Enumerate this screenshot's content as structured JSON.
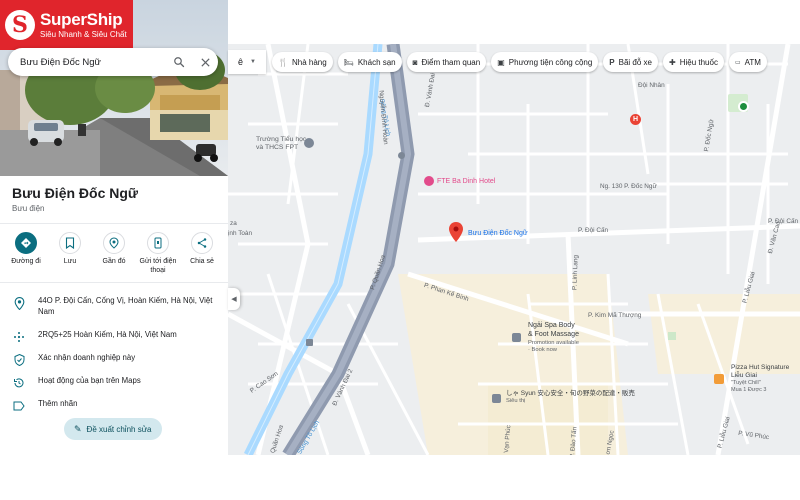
{
  "brand": {
    "logo_letter": "S",
    "name": "SuperShip",
    "slogan": "Siêu Nhanh & Siêu Chất"
  },
  "search": {
    "value": "Bưu Điện Đốc Ngữ",
    "placeholder": ""
  },
  "place": {
    "title": "Bưu Điện Đốc Ngữ",
    "category": "Bưu điện"
  },
  "actions": [
    {
      "label": "Đường đi",
      "icon": "directions-icon"
    },
    {
      "label": "Lưu",
      "icon": "bookmark-icon"
    },
    {
      "label": "Gần đó",
      "icon": "nearby-icon"
    },
    {
      "label": "Gửi tới điện thoại",
      "icon": "send-to-phone-icon"
    },
    {
      "label": "Chia sẻ",
      "icon": "share-icon"
    }
  ],
  "info": {
    "address": "44O P. Đội Cấn, Cống Vị, Hoàn Kiếm, Hà Nội, Việt Nam",
    "plus_code": "2RQ5+25 Hoàn Kiếm, Hà Nội, Việt Nam",
    "claim": "Xác nhận doanh nghiệp này",
    "activity": "Hoạt động của bạn trên Maps",
    "label": "Thêm nhãn"
  },
  "suggest_edit": "Đề xuất chỉnh sửa",
  "language_chip": "ê",
  "chips": [
    {
      "label": "Nhà hàng",
      "icon": "restaurant-icon"
    },
    {
      "label": "Khách sạn",
      "icon": "hotel-icon"
    },
    {
      "label": "Điểm tham quan",
      "icon": "camera-icon"
    },
    {
      "label": "Phương tiện công cộng",
      "icon": "transit-icon"
    },
    {
      "label": "Bãi đỗ xe",
      "icon": "parking-icon"
    },
    {
      "label": "Hiệu thuốc",
      "icon": "pharmacy-icon"
    },
    {
      "label": "ATM",
      "icon": "atm-icon"
    }
  ],
  "map": {
    "marker_label": "Bưu Điện Đốc Ngữ",
    "hotel": "FTE Ba Dinh Hotel",
    "school": [
      "Trường Tiểu học",
      "và THCS FPT"
    ],
    "spa": {
      "name1": "Ngải Spa Body",
      "name2": "& Foot Massage",
      "promo": "Promotion available",
      "cta": "· Book now"
    },
    "syun": "しゃ Syun 安心安全・旬の野菜の配達・販売",
    "syun_sub": "Siêu thị",
    "pizza": {
      "name1": "Pizza Hut Signature",
      "name2": "Liễu Giai",
      "sub1": "\"Tuyệt Chill\"",
      "sub2": "Mua 1 Được 3"
    },
    "roads": {
      "doi_can_1": "P. Đội Cấn",
      "doi_can_2": "P. Đội Cấn",
      "doi_can_top": "P. Đội Cấn",
      "ngo_130": "Ng. 130 P. Đốc Ngữ",
      "doc_ngu": "P. Đốc Ngữ",
      "doi_nhan": "Đội Nhân",
      "van_cao": "Đ. Văn Cao",
      "lieu_giai": "P. Liễu Giai",
      "lieu_giai_2": "P. Liễu Giai",
      "kim_ma": "P. Kim Mã Thượng",
      "phan_ke_binh": "P. Phan Kế Bính",
      "linh_lang": "P. Linh Lang",
      "quan_hoa": "P. Quần Hoa",
      "quan_hoa_2": "P. Quần Hoa",
      "vanh_dai_2": "Đ. Vành Đai 2",
      "vanh_dai_1": "Đ. Vành Đai 1",
      "song_to_lich": "Sông Tô Lịch",
      "song_to_lich_2": "Sông Tô Lịch",
      "nguyen_dinh_hoan": "Nguyễn Đình Hoàn",
      "cao_son": "P. Cao Sơn",
      "vu_phuc": "P. Vũ Phúc",
      "dao_tan": "P. Đào Tấn",
      "van_phuc": "P. Vạn Phúc",
      "inh_toan": "ịnh Toàn",
      "za": "za",
      "ngoc": "ơn Ngọc"
    }
  },
  "colors": {
    "brand": "#e0252c",
    "accent": "#0b6e80",
    "marker": "#ea4335",
    "hotel_pink": "#e24b8b",
    "river": "#aadaff",
    "highway": "#8f9aaf"
  }
}
